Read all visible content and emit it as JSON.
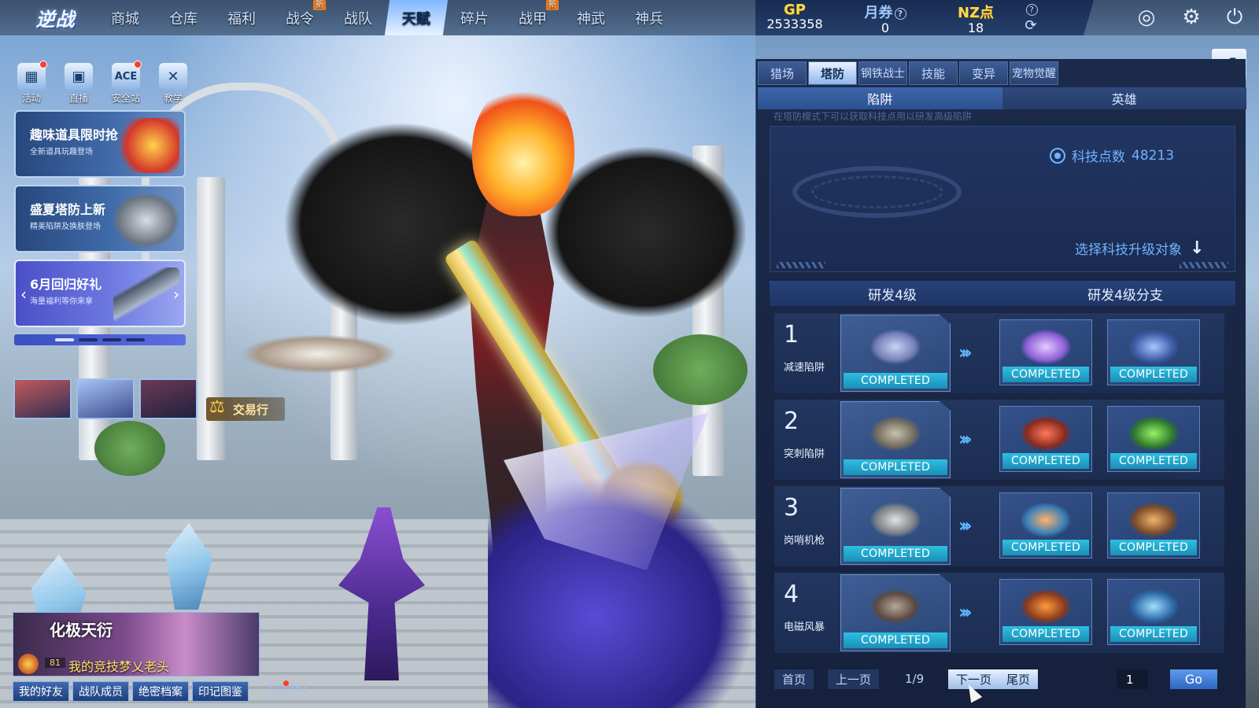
{
  "game": {
    "logo_text": "逆战"
  },
  "nav": {
    "items": [
      {
        "label": "商城"
      },
      {
        "label": "仓库"
      },
      {
        "label": "福利"
      },
      {
        "label": "战令",
        "badge": "新"
      },
      {
        "label": "战队"
      },
      {
        "label": "天赋",
        "active": true
      },
      {
        "label": "碎片"
      },
      {
        "label": "战甲",
        "badge": "新"
      },
      {
        "label": "神武"
      },
      {
        "label": "神兵"
      }
    ]
  },
  "currency": {
    "gp_label": "GP",
    "gp_value": "2533358",
    "ticket_label": "月券",
    "ticket_value": "0",
    "nz_label": "NZ点",
    "nz_value": "18"
  },
  "top_icons": [
    "radar-icon",
    "gear-icon",
    "power-icon"
  ],
  "side_icons": [
    {
      "label": "活动",
      "icon": "calendar-icon",
      "dot": true
    },
    {
      "label": "直播",
      "icon": "tv-icon",
      "dot": false
    },
    {
      "label": "安全站",
      "icon": "ace-icon",
      "dot": true
    },
    {
      "label": "教学",
      "icon": "crossed-swords-icon",
      "dot": false
    }
  ],
  "promos": [
    {
      "title": "趣味道具限时抢",
      "sub": "全新道具玩趣登场"
    },
    {
      "title": "盛夏塔防上新",
      "sub": "精美陷阱及换肤登场"
    },
    {
      "title": "6月回归好礼",
      "sub": "海量福利等你来拿"
    }
  ],
  "trade": {
    "label": "交易行"
  },
  "banner": {
    "title": "化极天衍",
    "level": "81",
    "text": "我的竞技梦乂老头"
  },
  "bottom_buttons": [
    "我的好友",
    "战队成员",
    "绝密档案",
    "印记图鉴"
  ],
  "mail": {
    "count": "(5)"
  },
  "panel": {
    "tabs": [
      "猎场",
      "塔防",
      "钢铁战士",
      "技能",
      "变异",
      "宠物觉醒"
    ],
    "active_tab": "塔防",
    "sub_tabs": [
      "陷阱",
      "英雄"
    ],
    "hint": "在塔防模式下可以获取科技点用以研发高级陷阱",
    "tech_points_label": "科技点数",
    "tech_points": "48213",
    "select_label": "选择科技升级对象",
    "rd_header_left": "研发4级",
    "rd_header_right": "研发4级分支",
    "rows": [
      {
        "num": "1",
        "name": "减速陷阱",
        "status": "COMPLETED",
        "branch_a": "COMPLETED",
        "branch_b": "COMPLETED"
      },
      {
        "num": "2",
        "name": "突刺陷阱",
        "status": "COMPLETED",
        "branch_a": "COMPLETED",
        "branch_b": "COMPLETED"
      },
      {
        "num": "3",
        "name": "岗哨机枪",
        "status": "COMPLETED",
        "branch_a": "COMPLETED",
        "branch_b": "COMPLETED"
      },
      {
        "num": "4",
        "name": "电磁风暴",
        "status": "COMPLETED",
        "branch_a": "COMPLETED",
        "branch_b": "COMPLETED"
      }
    ],
    "pager": {
      "first": "首页",
      "prev": "上一页",
      "info": "1/9",
      "next": "下一页",
      "last": "尾页",
      "input_value": "1",
      "go": "Go"
    }
  }
}
